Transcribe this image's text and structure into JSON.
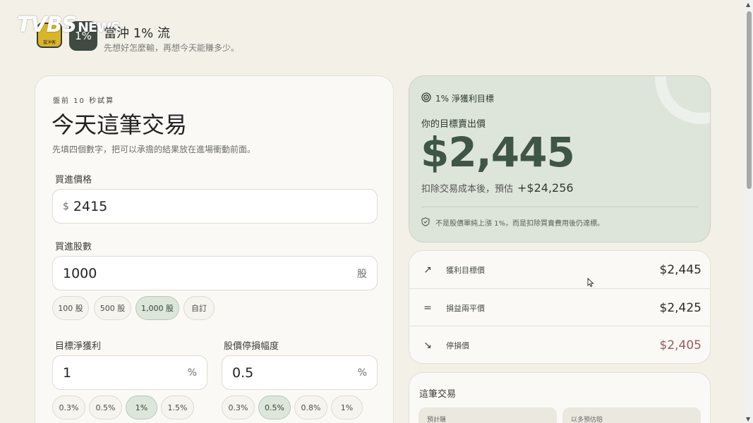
{
  "header": {
    "watermark_text": "TVBS",
    "watermark_news": "NEWS",
    "badge_small_text": "當沖客",
    "badge_dark_text": "1%",
    "title": "當沖 1% 流",
    "subtitle": "先想好怎麼輸，再想今天能賺多少。"
  },
  "calculator": {
    "eyebrow": "盤前 10 秒試算",
    "headline": "今天這筆交易",
    "intro": "先填四個數字，把可以承擔的結果放在進場衝動前面。",
    "buy_price": {
      "label": "買進價格",
      "prefix": "$",
      "value": "2415"
    },
    "shares": {
      "label": "買進股數",
      "value": "1000",
      "unit": "股",
      "presets": [
        {
          "label": "100 股",
          "active": false
        },
        {
          "label": "500 股",
          "active": false
        },
        {
          "label": "1,000 股",
          "active": true
        },
        {
          "label": "自訂",
          "active": false
        }
      ]
    },
    "target_profit": {
      "label": "目標淨獲利",
      "value": "1",
      "unit": "%",
      "presets": [
        {
          "label": "0.3%",
          "active": false
        },
        {
          "label": "0.5%",
          "active": false
        },
        {
          "label": "1%",
          "active": true
        },
        {
          "label": "1.5%",
          "active": false
        }
      ]
    },
    "stop_loss": {
      "label": "股價停損幅度",
      "value": "0.5",
      "unit": "%",
      "presets": [
        {
          "label": "0.3%",
          "active": false
        },
        {
          "label": "0.5%",
          "active": true
        },
        {
          "label": "0.8%",
          "active": false
        },
        {
          "label": "1%",
          "active": false
        }
      ]
    }
  },
  "target": {
    "heading": "1% 淨獲利目標",
    "sub": "你的目標賣出價",
    "price": "$2,445",
    "profit_label": "扣除交易成本後，預估",
    "profit_value": "+$24,256",
    "note": "不是股價單純上漲 1%，而是扣除買賣費用後仍達標。"
  },
  "price_levels": [
    {
      "icon": "arrow-up-right-icon",
      "glyph": "↗",
      "label": "獲利目標價",
      "price": "$2,445",
      "tone": "normal"
    },
    {
      "icon": "equals-icon",
      "glyph": "=",
      "label": "損益兩平價",
      "price": "$2,425",
      "tone": "normal"
    },
    {
      "icon": "arrow-down-right-icon",
      "glyph": "↘",
      "label": "停損價",
      "price": "$2,405",
      "tone": "loss"
    }
  ],
  "trade": {
    "title": "這筆交易",
    "stat_1_label": "預計賺",
    "stat_2_label": "以多預估賠"
  },
  "colors": {
    "accent_green": "#3f5647",
    "target_bg": "#dde5da",
    "loss_red": "#9a5a5e",
    "page_bg": "#f3f0e8"
  }
}
